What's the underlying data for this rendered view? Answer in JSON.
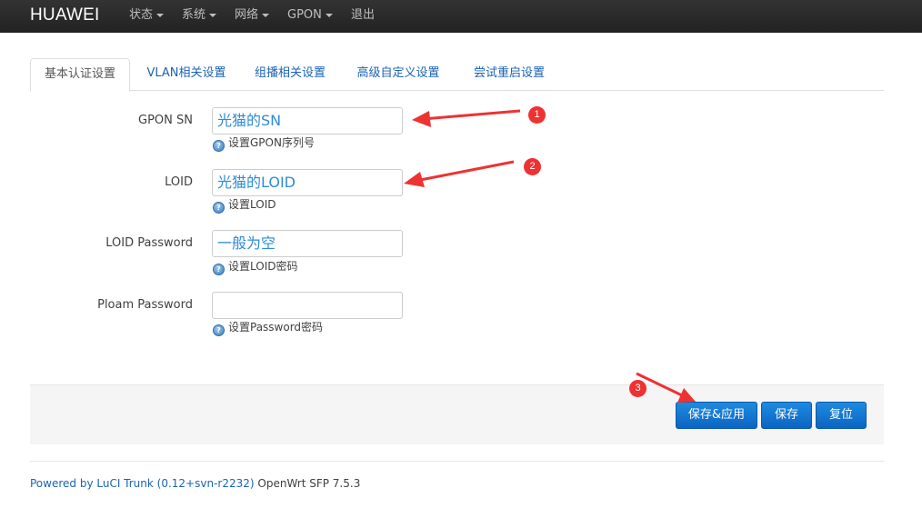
{
  "navbar": {
    "brand": "HUAWEI",
    "items": [
      {
        "label": "状态",
        "dropdown": true
      },
      {
        "label": "系统",
        "dropdown": true
      },
      {
        "label": "网络",
        "dropdown": true
      },
      {
        "label": "GPON",
        "dropdown": true
      },
      {
        "label": "退出",
        "dropdown": false
      }
    ]
  },
  "tabs": [
    {
      "label": "基本认证设置",
      "active": true
    },
    {
      "label": "VLAN相关设置",
      "active": false
    },
    {
      "label": "组播相关设置",
      "active": false
    },
    {
      "label": "高级自定义设置",
      "active": false
    },
    {
      "label": "尝试重启设置",
      "active": false
    }
  ],
  "form": {
    "gpon_sn": {
      "label": "GPON SN",
      "value": "光猫的SN",
      "hint": "设置GPON序列号"
    },
    "loid": {
      "label": "LOID",
      "value": "光猫的LOID",
      "hint": "设置LOID"
    },
    "loid_password": {
      "label": "LOID Password",
      "value": "一般为空",
      "hint": "设置LOID密码"
    },
    "ploam_password": {
      "label": "Ploam Password",
      "value": "",
      "hint": "设置Password密码"
    }
  },
  "actions": {
    "save_apply": "保存&应用",
    "save": "保存",
    "reset": "复位"
  },
  "footer": {
    "link_text": "Powered by LuCI Trunk (0.12+svn-r2232)",
    "version": "OpenWrt SFP 7.5.3"
  },
  "annotations": {
    "markers": [
      "1",
      "2",
      "3"
    ],
    "color": "#ee3232"
  },
  "colors": {
    "navbar": "#222222",
    "link": "#1b63b5",
    "button": "#0a65c2",
    "input_text": "#2e8bd8"
  },
  "icons": {
    "help": "help-icon",
    "caret": "caret-down-icon"
  }
}
